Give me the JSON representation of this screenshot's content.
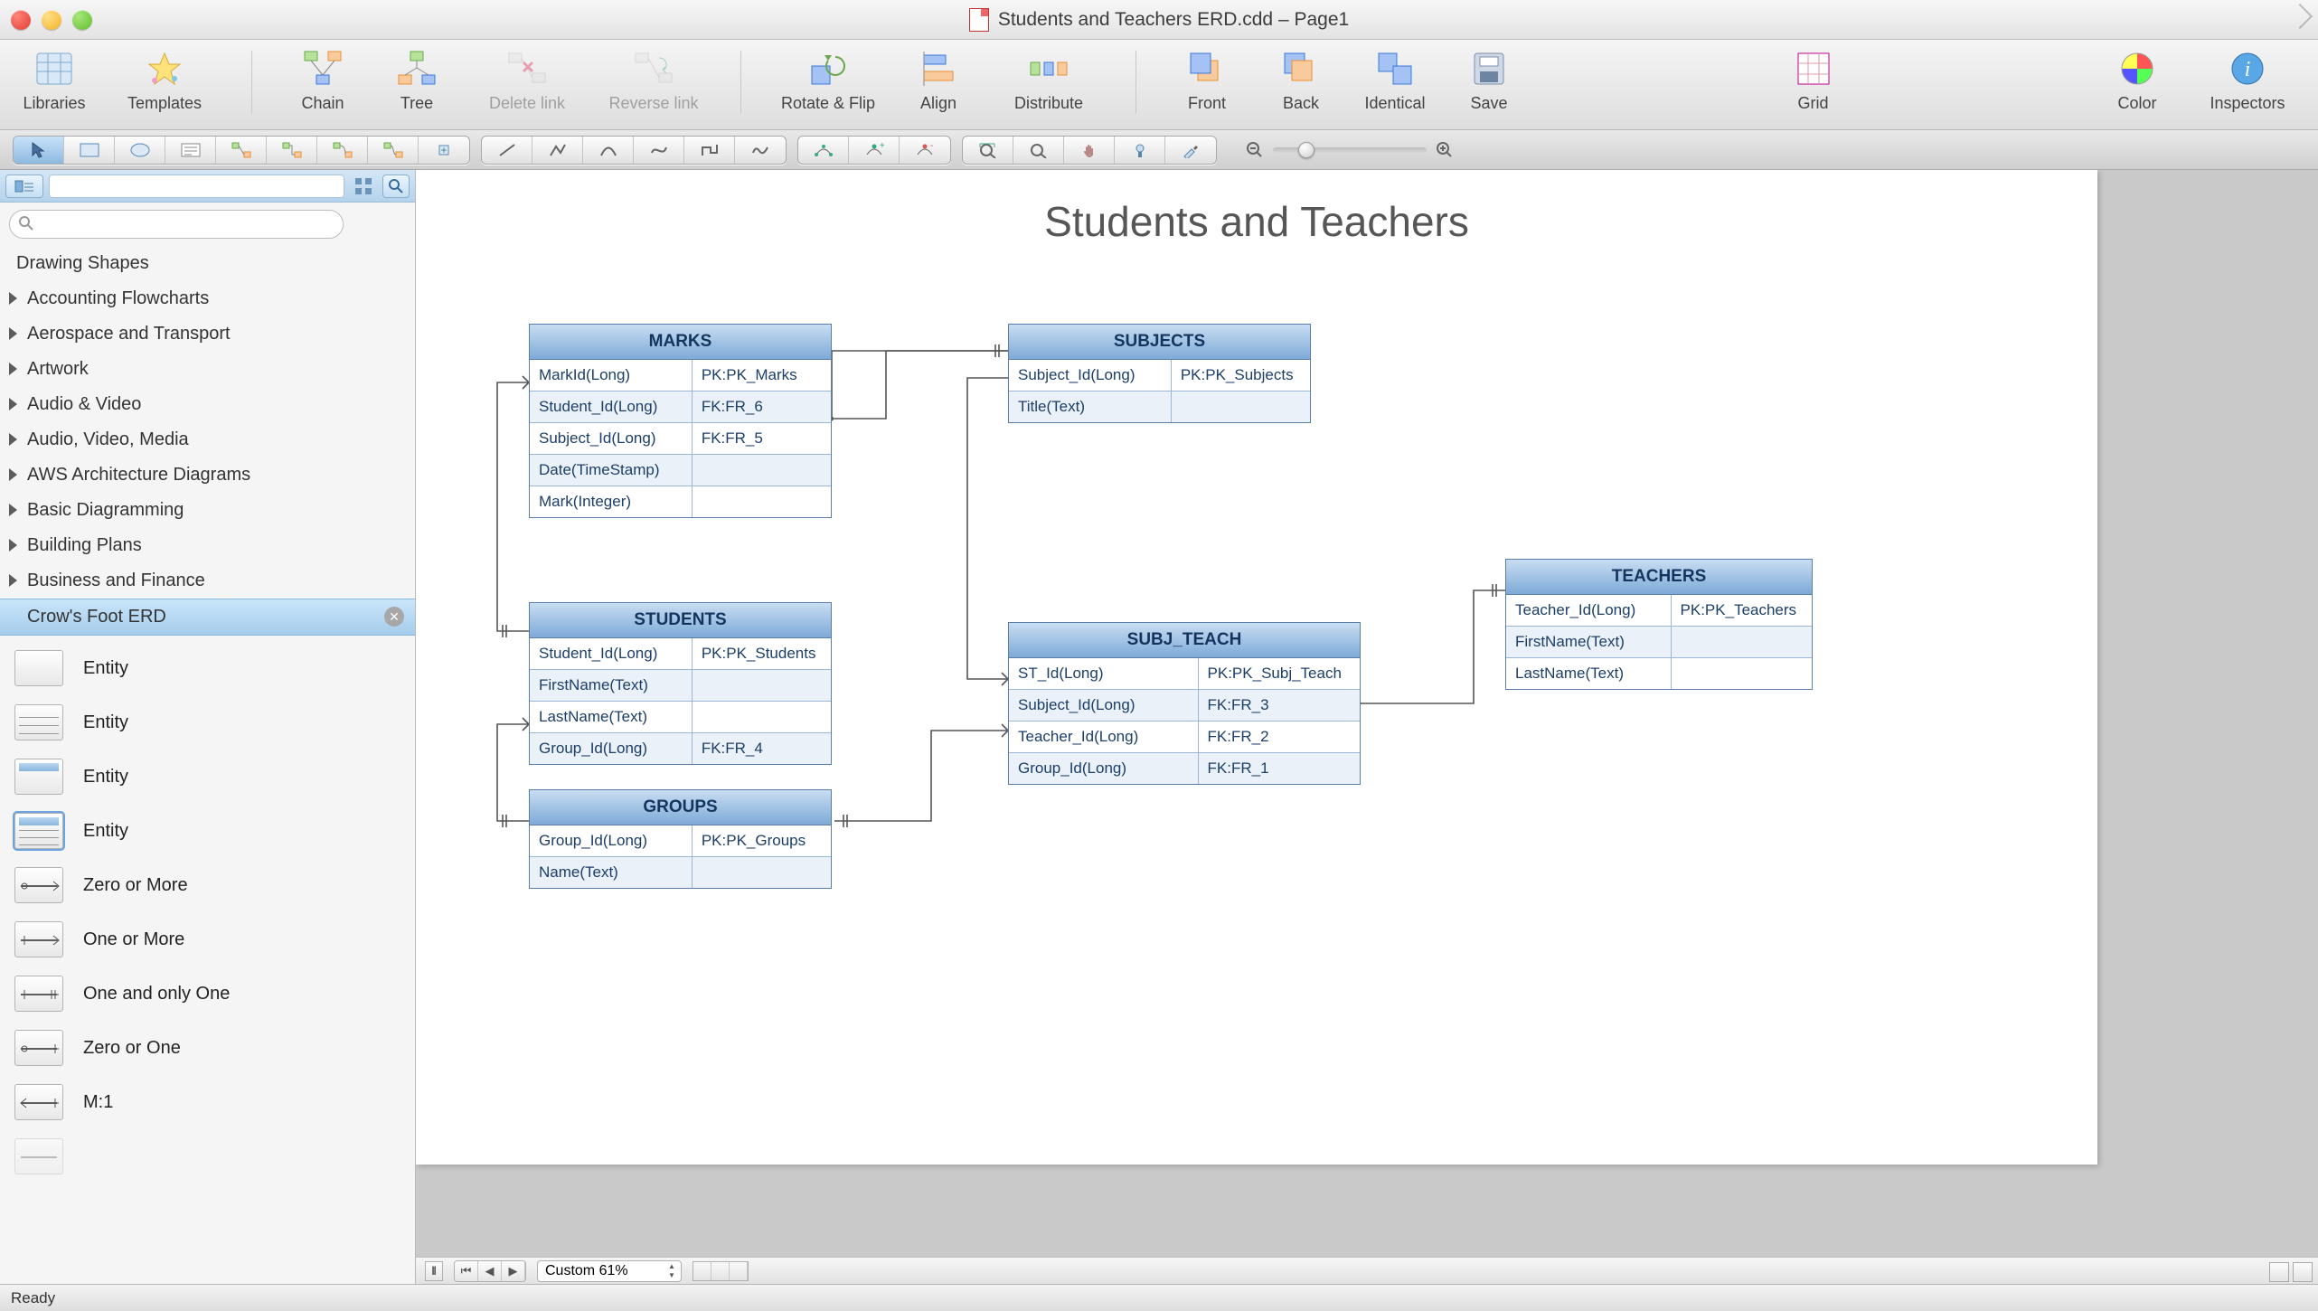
{
  "window": {
    "title": "Students and Teachers ERD.cdd – Page1"
  },
  "toolbar": {
    "items": [
      {
        "id": "libraries",
        "label": "Libraries"
      },
      {
        "id": "templates",
        "label": "Templates"
      },
      {
        "id": "chain",
        "label": "Chain"
      },
      {
        "id": "tree",
        "label": "Tree"
      },
      {
        "id": "delete-link",
        "label": "Delete link",
        "disabled": true
      },
      {
        "id": "reverse-link",
        "label": "Reverse link",
        "disabled": true
      },
      {
        "id": "rotate-flip",
        "label": "Rotate & Flip"
      },
      {
        "id": "align",
        "label": "Align"
      },
      {
        "id": "distribute",
        "label": "Distribute"
      },
      {
        "id": "front",
        "label": "Front"
      },
      {
        "id": "back",
        "label": "Back"
      },
      {
        "id": "identical",
        "label": "Identical"
      },
      {
        "id": "save",
        "label": "Save"
      },
      {
        "id": "grid",
        "label": "Grid"
      },
      {
        "id": "color",
        "label": "Color"
      },
      {
        "id": "inspectors",
        "label": "Inspectors"
      }
    ]
  },
  "sidebar": {
    "search_placeholder": "",
    "categories": [
      {
        "label": "Drawing Shapes",
        "top": true
      },
      {
        "label": "Accounting Flowcharts"
      },
      {
        "label": "Aerospace and Transport"
      },
      {
        "label": "Artwork"
      },
      {
        "label": "Audio & Video"
      },
      {
        "label": "Audio, Video, Media"
      },
      {
        "label": "AWS Architecture Diagrams"
      },
      {
        "label": "Basic Diagramming"
      },
      {
        "label": "Building Plans"
      },
      {
        "label": "Business and Finance"
      }
    ],
    "current_library": "Crow's Foot ERD",
    "palette": [
      {
        "label": "Entity",
        "kind": "entity-blank"
      },
      {
        "label": "Entity",
        "kind": "entity-rows"
      },
      {
        "label": "Entity",
        "kind": "entity-hdr"
      },
      {
        "label": "Entity",
        "kind": "entity-hdr-rows",
        "selected": true
      },
      {
        "label": "Zero or More",
        "kind": "conn"
      },
      {
        "label": "One or More",
        "kind": "conn"
      },
      {
        "label": "One and only One",
        "kind": "conn"
      },
      {
        "label": "Zero or One",
        "kind": "conn"
      },
      {
        "label": "M:1",
        "kind": "conn"
      }
    ]
  },
  "diagram": {
    "title": "Students and Teachers",
    "entities": {
      "marks": {
        "name": "MARKS",
        "rows": [
          {
            "c1": "MarkId(Long)",
            "c2": "PK:PK_Marks"
          },
          {
            "c1": "Student_Id(Long)",
            "c2": "FK:FR_6"
          },
          {
            "c1": "Subject_Id(Long)",
            "c2": "FK:FR_5"
          },
          {
            "c1": "Date(TimeStamp)",
            "c2": ""
          },
          {
            "c1": "Mark(Integer)",
            "c2": ""
          }
        ]
      },
      "subjects": {
        "name": "SUBJECTS",
        "rows": [
          {
            "c1": "Subject_Id(Long)",
            "c2": "PK:PK_Subjects"
          },
          {
            "c1": "Title(Text)",
            "c2": ""
          }
        ]
      },
      "students": {
        "name": "STUDENTS",
        "rows": [
          {
            "c1": "Student_Id(Long)",
            "c2": "PK:PK_Students"
          },
          {
            "c1": "FirstName(Text)",
            "c2": ""
          },
          {
            "c1": "LastName(Text)",
            "c2": ""
          },
          {
            "c1": "Group_Id(Long)",
            "c2": "FK:FR_4"
          }
        ]
      },
      "subj_teach": {
        "name": "SUBJ_TEACH",
        "rows": [
          {
            "c1": "ST_Id(Long)",
            "c2": "PK:PK_Subj_Teach"
          },
          {
            "c1": "Subject_Id(Long)",
            "c2": "FK:FR_3"
          },
          {
            "c1": "Teacher_Id(Long)",
            "c2": "FK:FR_2"
          },
          {
            "c1": "Group_Id(Long)",
            "c2": "FK:FR_1"
          }
        ]
      },
      "teachers": {
        "name": "TEACHERS",
        "rows": [
          {
            "c1": "Teacher_Id(Long)",
            "c2": "PK:PK_Teachers"
          },
          {
            "c1": "FirstName(Text)",
            "c2": ""
          },
          {
            "c1": "LastName(Text)",
            "c2": ""
          }
        ]
      },
      "groups": {
        "name": "GROUPS",
        "rows": [
          {
            "c1": "Group_Id(Long)",
            "c2": "PK:PK_Groups"
          },
          {
            "c1": "Name(Text)",
            "c2": ""
          }
        ]
      }
    }
  },
  "footer": {
    "zoom_label": "Custom 61%",
    "status": "Ready"
  }
}
